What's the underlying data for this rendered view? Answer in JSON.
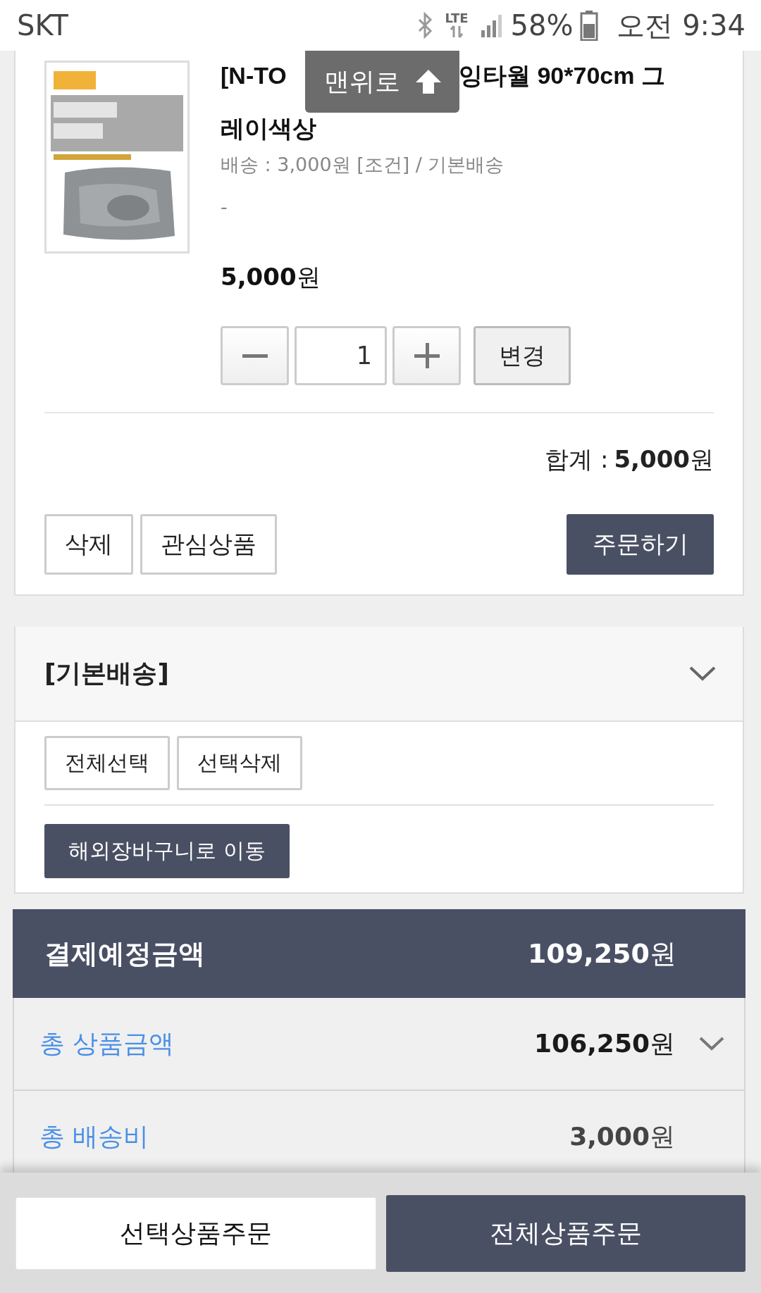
{
  "status_bar": {
    "carrier": "SKT",
    "network": "LTE",
    "battery": "58%",
    "time": "오전 9:34"
  },
  "scroll_top_button": {
    "label": "맨위로"
  },
  "cart_item": {
    "title_parts": [
      "[N-TO",
      "잉타월 90*70cm 그",
      "레이색상"
    ],
    "shipping": "배송 : 3,000원 [조건] / 기본배송",
    "option": "-",
    "price": "**5,000**원",
    "quantity": "1",
    "change_button": "변경",
    "subtotal_label": "합계 :",
    "subtotal": "**5,000**원",
    "actions": [
      {
        "label": "삭제",
        "kind": "outline"
      },
      {
        "label": "관심상품",
        "kind": "outline"
      },
      {
        "label": "주문하기",
        "kind": "primary"
      }
    ]
  },
  "shipping_group": {
    "title": "[기본배송]",
    "buttons": [
      "전체선택",
      "선택삭제"
    ],
    "move_button": "해외장바구니로 이동"
  },
  "summary": {
    "title": "결제예정금액",
    "total": "**109,250**원",
    "rows": [
      {
        "label": "총 상품금액",
        "value": "**106,250**원",
        "expandable": true
      },
      {
        "label": "총 배송비",
        "value": "**3,000**원",
        "expandable": false
      }
    ]
  },
  "bottom_bar": [
    {
      "label": "선택상품주문",
      "kind": "outline"
    },
    {
      "label": "전체상품주문",
      "kind": "primary"
    }
  ]
}
